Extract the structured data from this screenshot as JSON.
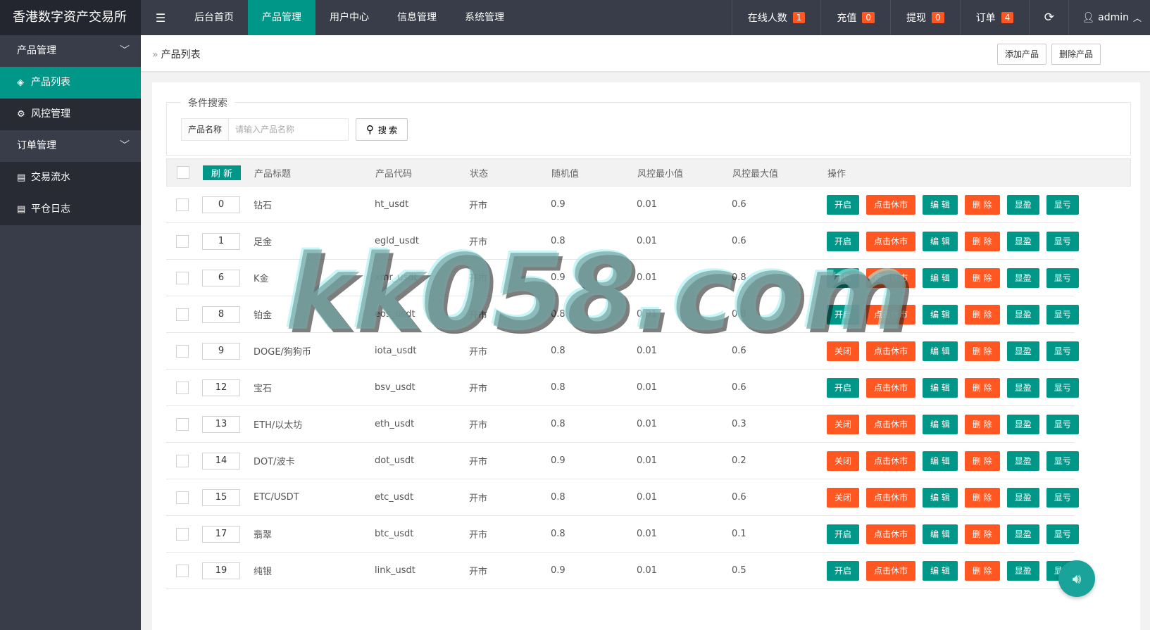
{
  "app": {
    "title": "香港数字资产交易所"
  },
  "topnav": [
    {
      "label": "后台首页",
      "active": false
    },
    {
      "label": "产品管理",
      "active": true
    },
    {
      "label": "用户中心",
      "active": false
    },
    {
      "label": "信息管理",
      "active": false
    },
    {
      "label": "系统管理",
      "active": false
    }
  ],
  "rightnav": {
    "online": {
      "label": "在线人数",
      "count": "1"
    },
    "recharge": {
      "label": "充值",
      "count": "0"
    },
    "withdraw": {
      "label": "提现",
      "count": "0"
    },
    "orders": {
      "label": "订单",
      "count": "4"
    },
    "refresh_icon": "refresh-icon",
    "user": "admin"
  },
  "sidebar": {
    "groups": [
      {
        "label": "产品管理",
        "items": [
          {
            "label": "产品列表",
            "icon": "layers-icon",
            "active": true
          },
          {
            "label": "风控管理",
            "icon": "gear-icon",
            "active": false
          }
        ]
      },
      {
        "label": "订单管理",
        "items": [
          {
            "label": "交易流水",
            "icon": "doc-icon",
            "active": false
          },
          {
            "label": "平仓日志",
            "icon": "doc-icon",
            "active": false
          }
        ]
      }
    ]
  },
  "breadcrumb": "产品列表",
  "toolbar": {
    "add": "添加产品",
    "delete": "删除产品"
  },
  "search": {
    "legend": "条件搜索",
    "label": "产品名称",
    "placeholder": "请输入产品名称",
    "button": "搜 索"
  },
  "table": {
    "refresh": "刷 新",
    "headers": [
      "产品标题",
      "产品代码",
      "状态",
      "随机值",
      "风控最小值",
      "风控最大值",
      "操作"
    ],
    "actions": {
      "open": "开启",
      "close": "关闭",
      "rest": "点击休市",
      "edit": "编 辑",
      "del": "删 除",
      "profit": "显盈",
      "loss": "显亏"
    },
    "rows": [
      {
        "sort": "0",
        "title": "钻石",
        "code": "ht_usdt",
        "status": "开市",
        "rand": "0.9",
        "min": "0.01",
        "max": "0.6",
        "toggle": "open"
      },
      {
        "sort": "1",
        "title": "足金",
        "code": "egld_usdt",
        "status": "开市",
        "rand": "0.8",
        "min": "0.01",
        "max": "0.6",
        "toggle": "open"
      },
      {
        "sort": "6",
        "title": "K金",
        "code": "xmr_usdt",
        "status": "开市",
        "rand": "0.9",
        "min": "0.01",
        "max": "0.8",
        "toggle": "open"
      },
      {
        "sort": "8",
        "title": "铂金",
        "code": "eos_usdt",
        "status": "开市",
        "rand": "0.8",
        "min": "0.01",
        "max": "0.8",
        "toggle": "open"
      },
      {
        "sort": "9",
        "title": "DOGE/狗狗币",
        "code": "iota_usdt",
        "status": "开市",
        "rand": "0.8",
        "min": "0.01",
        "max": "0.6",
        "toggle": "close"
      },
      {
        "sort": "12",
        "title": "宝石",
        "code": "bsv_usdt",
        "status": "开市",
        "rand": "0.8",
        "min": "0.01",
        "max": "0.6",
        "toggle": "open"
      },
      {
        "sort": "13",
        "title": "ETH/以太坊",
        "code": "eth_usdt",
        "status": "开市",
        "rand": "0.8",
        "min": "0.01",
        "max": "0.3",
        "toggle": "close"
      },
      {
        "sort": "14",
        "title": "DOT/波卡",
        "code": "dot_usdt",
        "status": "开市",
        "rand": "0.9",
        "min": "0.01",
        "max": "0.2",
        "toggle": "close"
      },
      {
        "sort": "15",
        "title": "ETC/USDT",
        "code": "etc_usdt",
        "status": "开市",
        "rand": "0.8",
        "min": "0.01",
        "max": "0.6",
        "toggle": "close"
      },
      {
        "sort": "17",
        "title": "翡翠",
        "code": "btc_usdt",
        "status": "开市",
        "rand": "0.8",
        "min": "0.01",
        "max": "0.1",
        "toggle": "open"
      },
      {
        "sort": "19",
        "title": "纯银",
        "code": "link_usdt",
        "status": "开市",
        "rand": "0.9",
        "min": "0.01",
        "max": "0.5",
        "toggle": "open"
      }
    ]
  },
  "watermark": "kk058.com",
  "colors": {
    "primary": "#009688",
    "danger": "#ff5722",
    "dark": "#393d49"
  }
}
